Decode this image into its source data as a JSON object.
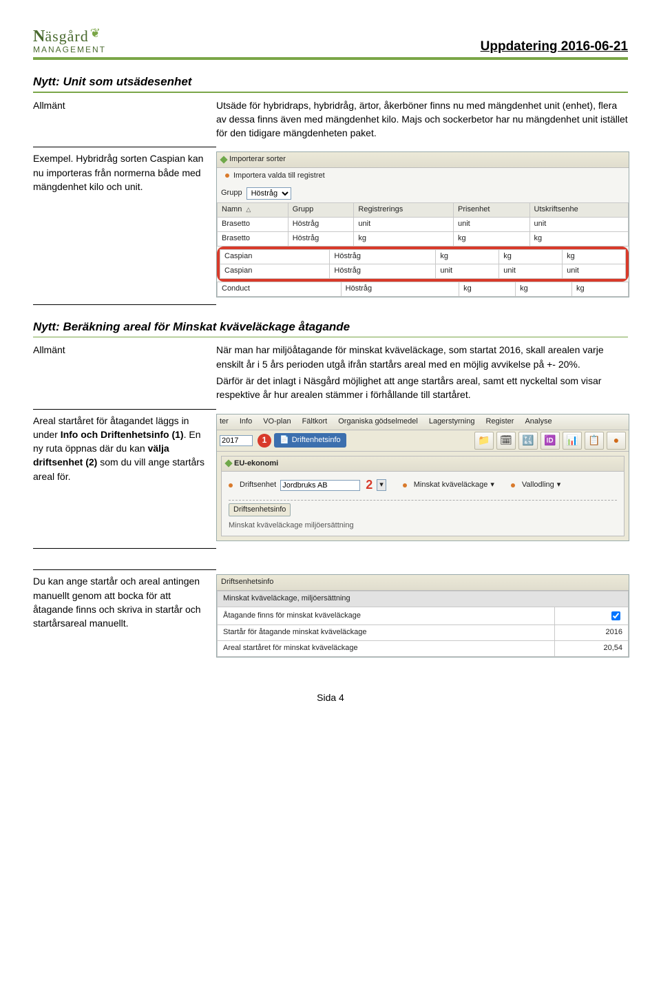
{
  "header": {
    "logo_n": "N",
    "logo_rest": "äsgård",
    "logo_mgmt": "MANAGEMENT",
    "page_title": "Uppdatering 2016-06-21"
  },
  "sections": {
    "s1": {
      "heading": "Nytt: Unit som utsädesenhet",
      "row1_left": "Allmänt",
      "row1_right": "Utsäde för hybridraps, hybridråg, ärtor, åkerböner finns nu med mängdenhet unit (enhet), flera av dessa finns även med mängdenhet kilo. Majs och sockerbetor har nu mängdenhet unit istället för den tidigare mängdenheten paket.",
      "row2_left": "Exempel. Hybridråg sorten Caspian kan nu importeras från normerna både med mängdenhet kilo och unit."
    },
    "s2": {
      "heading": "Nytt: Beräkning areal för Minskat kväveläckage åtagande",
      "row1_left": "Allmänt",
      "row1_right_p1": "När man har miljöåtagande för minskat kväveläckage, som startat 2016, skall arealen varje enskilt år i 5 års perioden utgå ifrån startårs areal med en möjlig avvikelse på +- 20%.",
      "row1_right_p2": "Därför är det inlagt i Näsgård möjlighet att ange startårs areal, samt ett nyckeltal som visar respektive år hur arealen stämmer i förhållande till startåret.",
      "row2_left_a": "Areal startåret för åtagandet läggs in under ",
      "row2_left_b": "Info och Driftenhetsinfo (1)",
      "row2_left_c": ". En ny ruta öppnas där du kan ",
      "row2_left_d": "välja driftsenhet (2)",
      "row2_left_e": " som du vill ange startårs areal för.",
      "row3_left": "Du kan ange startår och areal antingen manuellt genom att bocka för att åtagande finns och skriva in startår och startårsareal manuellt."
    }
  },
  "ss1": {
    "title": "Importerar sorter",
    "import_label": "Importera valda till registret",
    "group_label": "Grupp",
    "group_value": "Höstråg",
    "headers": [
      "Namn",
      "Grupp",
      "Registrerings",
      "Prisenhet",
      "Utskriftsenhe"
    ],
    "rows_top": [
      [
        "Brasetto",
        "Höstråg",
        "unit",
        "unit",
        "unit"
      ],
      [
        "Brasetto",
        "Höstråg",
        "kg",
        "kg",
        "kg"
      ]
    ],
    "rows_hl": [
      [
        "Caspian",
        "Höstråg",
        "kg",
        "kg",
        "kg"
      ],
      [
        "Caspian",
        "Höstråg",
        "unit",
        "unit",
        "unit"
      ]
    ],
    "rows_bottom": [
      [
        "Conduct",
        "Höstråg",
        "kg",
        "kg",
        "kg"
      ]
    ]
  },
  "ss2": {
    "menu": [
      "ter",
      "Info",
      "VO-plan",
      "Fältkort",
      "Organiska gödselmedel",
      "Lagerstyrning",
      "Register",
      "Analyse"
    ],
    "year": "2017",
    "drift_label": "Driftenhetsinfo",
    "marker1": "1",
    "eu_title": "EU-ekonomi",
    "row_items": {
      "driftsenhet": "Driftsenhet",
      "driftsenhet_val": "Jordbruks AB",
      "marker2": "2",
      "minskat": "Minskat kväveläckage",
      "vallodling": "Vallodling"
    },
    "tab": "Driftsenhetsinfo",
    "footer_line": "Minskat kväveläckage  miljöersättning"
  },
  "ss3": {
    "title": "Driftsenhetsinfo",
    "subhead": "Minskat kväveläckage, miljöersättning",
    "r1": "Åtagande finns för minskat kväveläckage",
    "r2": "Startår för åtagande minskat kväveläckage",
    "r2v": "2016",
    "r3": "Areal startåret för minskat kväveläckage",
    "r3v": "20,54"
  },
  "footer": "Sida 4"
}
